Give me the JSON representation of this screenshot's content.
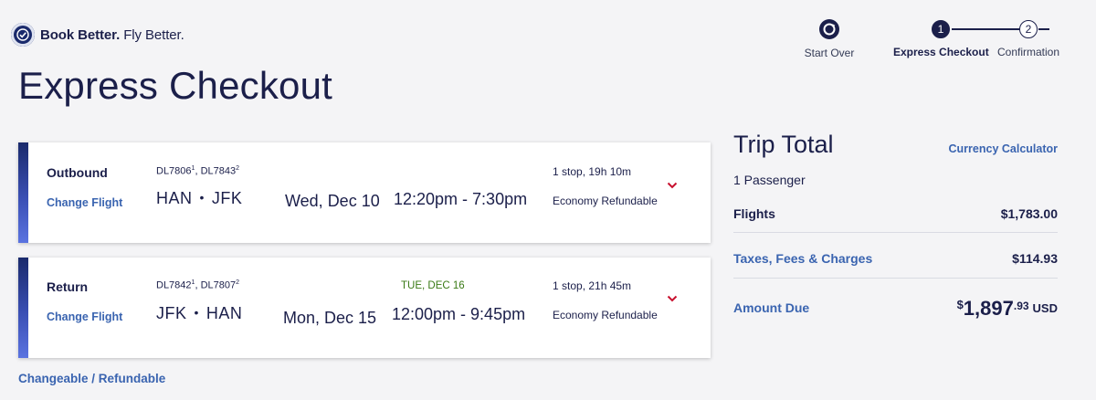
{
  "brand": {
    "name_bold": "Book Better.",
    "name_light": " Fly Better."
  },
  "progress": {
    "start_over": "Start Over",
    "steps": [
      {
        "number": "1",
        "label": "Express Checkout",
        "active": true
      },
      {
        "number": "2",
        "label": "Confirmation",
        "active": false
      }
    ]
  },
  "page": {
    "title": "Express Checkout"
  },
  "flights": [
    {
      "leg": "Outbound",
      "change_label": "Change Flight",
      "flight_1": "DL7806",
      "flight_1_sup": "1",
      "flight_2": "DL7843",
      "flight_2_sup": "2",
      "sep": ", ",
      "origin": "HAN",
      "destination": "JFK",
      "date": "Wed, Dec 10",
      "times": "12:20pm - 7:30pm",
      "arrival_note": "",
      "stops": "1 stop, 19h 10m",
      "fare": "Economy Refundable"
    },
    {
      "leg": "Return",
      "change_label": "Change Flight",
      "flight_1": "DL7842",
      "flight_1_sup": "1",
      "flight_2": "DL7807",
      "flight_2_sup": "2",
      "sep": ", ",
      "origin": "JFK",
      "destination": "HAN",
      "date": "Mon, Dec 15",
      "times": "12:00pm - 9:45pm",
      "arrival_note": "TUE, DEC 16",
      "stops": "1 stop, 21h 45m",
      "fare": "Economy Refundable"
    }
  ],
  "policy": "Changeable / Refundable",
  "trip_total": {
    "title": "Trip Total",
    "currency_link": "Currency Calculator",
    "passengers": "1 Passenger",
    "flights_label": "Flights",
    "flights_value": "$1,783.00",
    "taxes_label": "Taxes, Fees & Charges",
    "taxes_value": "$114.93",
    "due_label": "Amount Due",
    "due_symbol": "$",
    "due_whole": "1,897",
    "due_cents": ".93",
    "due_currency": "USD"
  },
  "colors": {
    "navy": "#1b1f4a",
    "link_blue": "#3a64b0",
    "arrival_green": "#3a7a16",
    "chevron_red": "#c8102e"
  },
  "icons": {
    "brand": "check-circle-logo-icon",
    "start_over": "rotate-icon",
    "expand": "chevron-down-icon"
  }
}
